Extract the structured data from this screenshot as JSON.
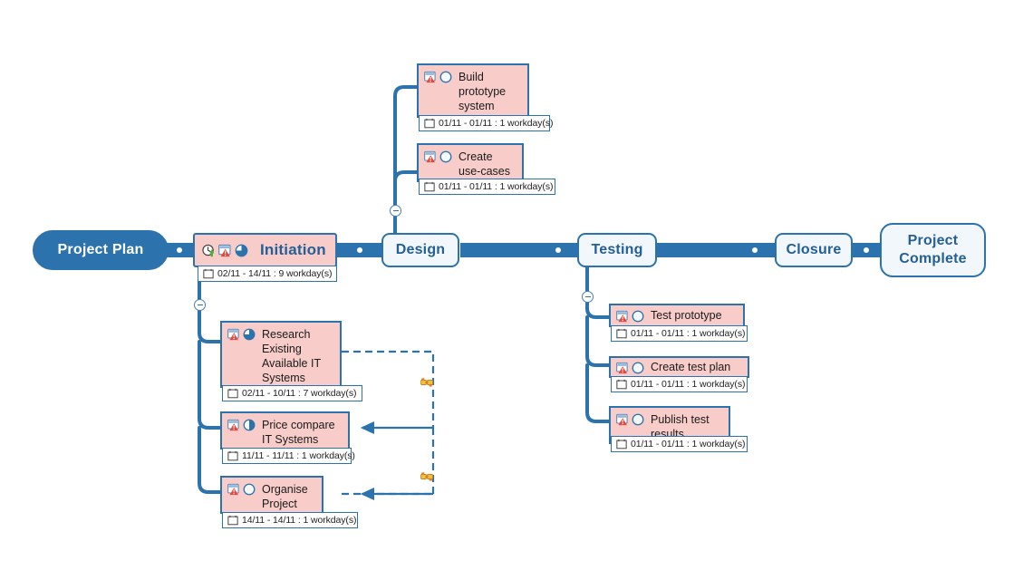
{
  "diagram": {
    "title": "Project Plan",
    "type": "project-mindmap-gantt"
  },
  "colors": {
    "spine": "#2c72ad",
    "root_fill": "#2c72ad",
    "spine_fill": "#f2f7fb",
    "task_fill": "#f7ccc9",
    "task_border": "#2c72ad",
    "text_blue": "#245f96",
    "date_text": "#222222",
    "dependency_line": "#2c72ad",
    "marker": "#e8a33d"
  },
  "root": {
    "label": "Project Plan"
  },
  "spine": [
    {
      "id": "design",
      "label": "Design"
    },
    {
      "id": "testing",
      "label": "Testing"
    },
    {
      "id": "closure",
      "label": "Closure"
    },
    {
      "id": "complete",
      "label": "Project\nComplete"
    }
  ],
  "spine_labels": {
    "design": "Design",
    "testing": "Testing",
    "closure": "Closure",
    "complete_line1": "Project",
    "complete_line2": "Complete"
  },
  "initiation": {
    "label": "Initiation",
    "date": "02/11 - 14/11 : 9 workday(s)",
    "icons": [
      "clock-arrow-icon",
      "alarm-alert-icon",
      "pie-progress-icon"
    ]
  },
  "design_children": [
    {
      "id": "build-prototype-system",
      "label": "Build\nprototype\nsystem",
      "date": "01/11 - 01/11 : 1 workday(s)",
      "icons": [
        "alarm-alert-icon",
        "progress-empty-icon"
      ]
    },
    {
      "id": "create-use-cases",
      "label": "Create\nuse-cases",
      "date": "01/11 - 01/11 : 1 workday(s)",
      "icons": [
        "alarm-alert-icon",
        "progress-empty-icon"
      ]
    }
  ],
  "initiation_children": [
    {
      "id": "research-existing-available-it-systems",
      "label": "Research\nExisting\nAvailable IT\nSystems",
      "date": "02/11 - 10/11 : 7 workday(s)",
      "icons": [
        "alarm-alert-icon",
        "progress-three-quarter-icon"
      ]
    },
    {
      "id": "price-compare-it-systems",
      "label": "Price compare\nIT Systems",
      "date": "11/11 - 11/11 : 1 workday(s)",
      "icons": [
        "alarm-alert-icon",
        "progress-half-icon"
      ]
    },
    {
      "id": "organise-project",
      "label": "Organise\nProject",
      "date": "14/11 - 14/11 : 1 workday(s)",
      "icons": [
        "alarm-alert-icon",
        "progress-empty-icon"
      ]
    }
  ],
  "testing_children": [
    {
      "id": "test-prototype",
      "label": "Test prototype",
      "date": "01/11 - 01/11 : 1 workday(s)",
      "icons": [
        "alarm-alert-icon",
        "progress-empty-icon"
      ]
    },
    {
      "id": "create-test-plan",
      "label": "Create test plan",
      "date": "01/11 - 01/11 : 1 workday(s)",
      "icons": [
        "alarm-alert-icon",
        "progress-empty-icon"
      ]
    },
    {
      "id": "publish-test-results",
      "label": "Publish test\nresults",
      "date": "01/11 - 01/11 : 1 workday(s)",
      "icons": [
        "alarm-alert-icon",
        "progress-empty-icon"
      ]
    }
  ],
  "collapse_toggles": [
    {
      "id": "design-collapse",
      "state": "expanded",
      "glyph": "minus"
    },
    {
      "id": "initiation-collapse",
      "state": "expanded",
      "glyph": "minus"
    },
    {
      "id": "testing-collapse",
      "state": "expanded",
      "glyph": "minus"
    }
  ],
  "dependencies": [
    {
      "id": "dep-research-to-price-compare",
      "from": "research-existing-available-it-systems",
      "to": "price-compare-it-systems",
      "style": "dashed-arrow"
    },
    {
      "id": "dep-price-compare-to-organise",
      "from": "price-compare-it-systems",
      "to": "organise-project",
      "style": "dashed-arrow"
    }
  ]
}
